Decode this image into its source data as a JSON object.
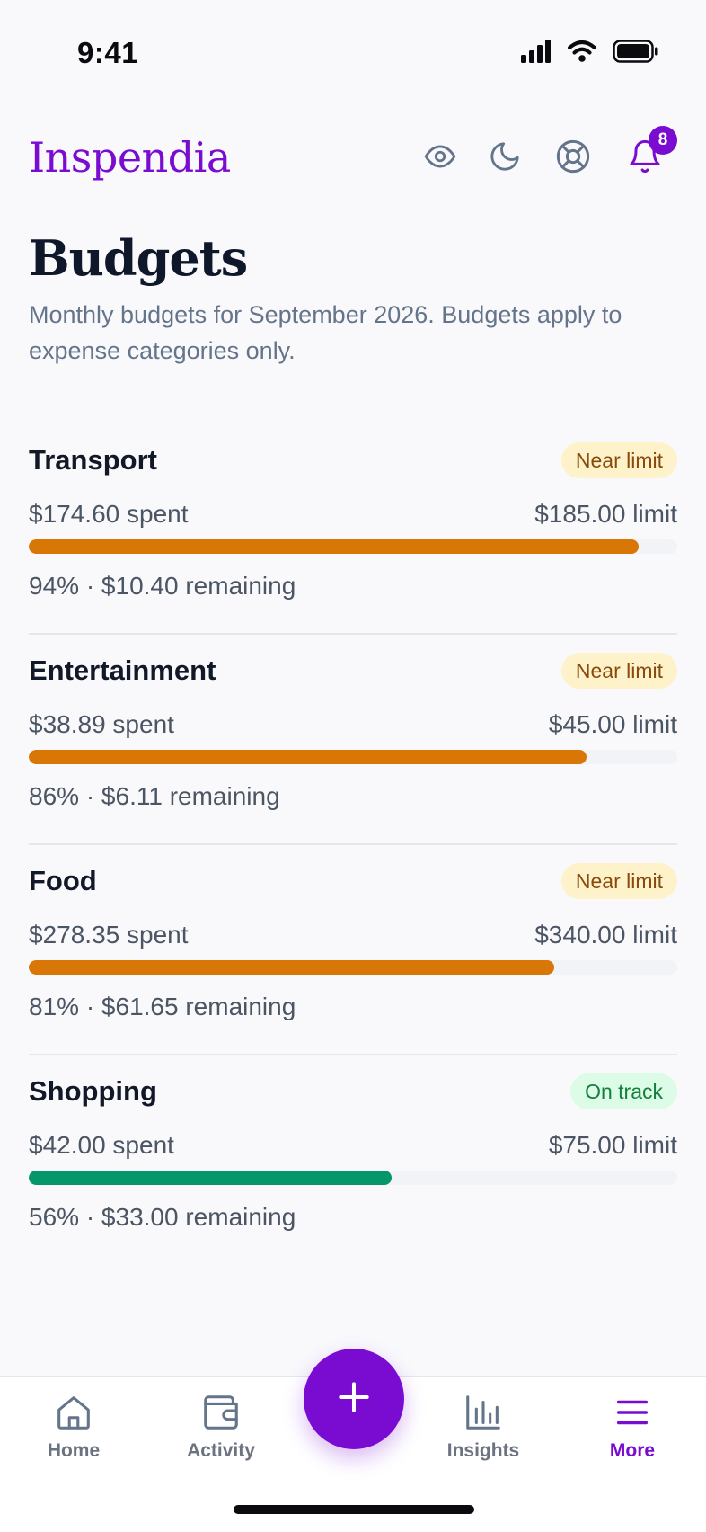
{
  "status_bar": {
    "time": "9:41"
  },
  "header": {
    "app_name": "Inspendia",
    "notification_count": "8"
  },
  "page": {
    "title": "Budgets",
    "subtitle": "Monthly budgets for September 2026. Budgets apply to expense categories only."
  },
  "budgets": [
    {
      "name": "Transport",
      "status": "Near limit",
      "status_type": "near",
      "spent": "$174.60 spent",
      "limit": "$185.00 limit",
      "progress_fraction": 0.94,
      "bar_color": "#d97706",
      "footer": "94% · $10.40 remaining"
    },
    {
      "name": "Entertainment",
      "status": "Near limit",
      "status_type": "near",
      "spent": "$38.89 spent",
      "limit": "$45.00 limit",
      "progress_fraction": 0.86,
      "bar_color": "#d97706",
      "footer": "86% · $6.11 remaining"
    },
    {
      "name": "Food",
      "status": "Near limit",
      "status_type": "near",
      "spent": "$278.35 spent",
      "limit": "$340.00 limit",
      "progress_fraction": 0.81,
      "bar_color": "#d97706",
      "footer": "81% · $61.65 remaining"
    },
    {
      "name": "Shopping",
      "status": "On track",
      "status_type": "ok",
      "spent": "$42.00 spent",
      "limit": "$75.00 limit",
      "progress_fraction": 0.56,
      "bar_color": "#059669",
      "footer": "56% · $33.00 remaining"
    }
  ],
  "nav": {
    "items": [
      {
        "label": "Home",
        "icon": "home-icon"
      },
      {
        "label": "Activity",
        "icon": "wallet-icon"
      },
      {
        "label": "Insights",
        "icon": "bar-chart-icon"
      },
      {
        "label": "More",
        "icon": "menu-icon"
      }
    ],
    "active": "More",
    "fab_icon": "plus-icon"
  },
  "colors": {
    "brand": "#7a0bd1",
    "warning": "#d97706",
    "success": "#059669",
    "text_muted": "#64748b"
  }
}
